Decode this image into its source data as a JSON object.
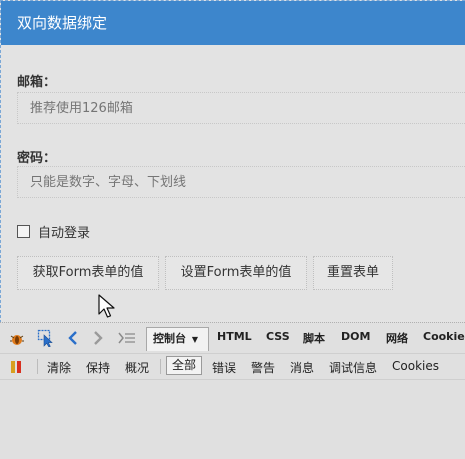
{
  "header": {
    "title": "双向数据绑定"
  },
  "form": {
    "email_label": "邮箱：",
    "email_placeholder": "推荐使用126邮箱",
    "password_label": "密码：",
    "password_placeholder": "只能是数字、字母、下划线",
    "remember_label": "自动登录",
    "remember_checked": false,
    "buttons": {
      "get": "获取Form表单的值",
      "set": "设置Form表单的值",
      "reset": "重置表单"
    }
  },
  "devtools": {
    "tabs": {
      "console": "控制台",
      "html": "HTML",
      "css": "CSS",
      "script": "脚本",
      "dom": "DOM",
      "net": "网络",
      "cookie": "Cookie"
    },
    "toolbar": {
      "clear": "清除",
      "persist": "保持",
      "profile": "概况",
      "all": "全部",
      "errors": "错误",
      "warnings": "警告",
      "info": "消息",
      "debug": "调试信息",
      "cookies": "Cookies"
    }
  },
  "colors": {
    "titlebar": "#3d86cc",
    "accent_arrow": "#2a6fc9",
    "bug_icon": "#e07a1a"
  }
}
